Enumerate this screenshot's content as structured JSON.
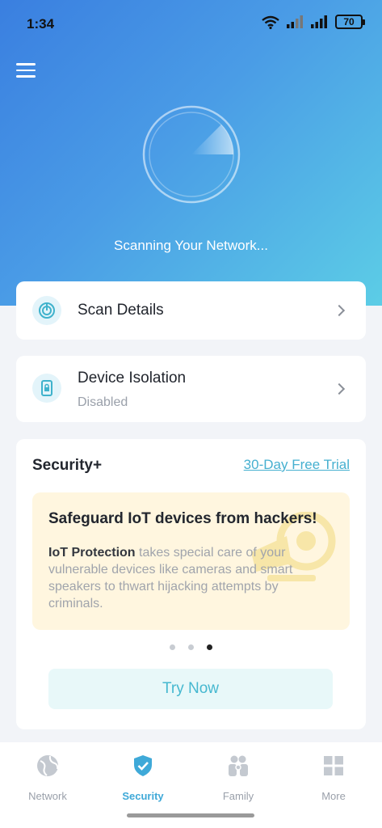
{
  "status_bar": {
    "time": "1:34",
    "battery": "70",
    "icons": [
      "wifi-icon",
      "signal-icon",
      "signal-icon",
      "battery-icon"
    ]
  },
  "header": {
    "menu_icon": "hamburger-menu-icon",
    "scan_status": "Scanning Your Network..."
  },
  "cards": {
    "scan_details": {
      "label": "Scan Details",
      "icon": "scan-radar-icon"
    },
    "device_isolation": {
      "label": "Device Isolation",
      "status": "Disabled",
      "icon": "device-lock-icon"
    }
  },
  "security_plus": {
    "title": "Security+",
    "trial_link": "30-Day Free Trial",
    "promo": {
      "title": "Safeguard IoT devices from hackers!",
      "body_bold": "IoT Protection",
      "body_rest": " takes special care of your vulnerable devices like cameras and smart speakers to thwart hijacking attempts by criminals.",
      "illustration": "camera-icon"
    },
    "carousel": {
      "total": 3,
      "active": 3
    },
    "try_button": "Try Now"
  },
  "tabbar": {
    "tabs": [
      {
        "label": "Network",
        "icon": "globe-icon",
        "active": false
      },
      {
        "label": "Security",
        "icon": "shield-check-icon",
        "active": true
      },
      {
        "label": "Family",
        "icon": "family-icon",
        "active": false
      },
      {
        "label": "More",
        "icon": "grid-icon",
        "active": false
      }
    ]
  },
  "colors": {
    "hero_start": "#3a7fe0",
    "hero_end": "#5ccde6",
    "accent": "#46b0d0",
    "active_tab": "#3fa9d8",
    "promo_bg": "#fff6df"
  }
}
